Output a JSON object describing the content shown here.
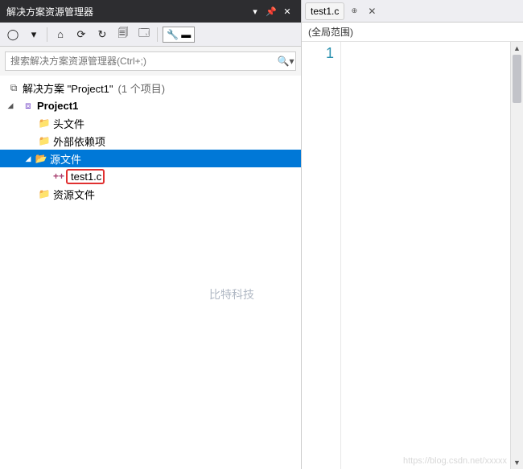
{
  "explorer": {
    "title": "解决方案资源管理器",
    "search_placeholder": "搜索解决方案资源管理器(Ctrl+;)"
  },
  "tree": {
    "solution_label": "解决方案 \"Project1\"",
    "solution_count": "(1 个项目)",
    "project": "Project1",
    "headers": "头文件",
    "external": "外部依赖项",
    "sources": "源文件",
    "file": "test1.c",
    "resources": "资源文件"
  },
  "watermark": "比特科技",
  "editor": {
    "tab_name": "test1.c",
    "scope": "(全局范围)",
    "line_number": "1"
  },
  "footer": "https://blog.csdn.net/xxxxx"
}
